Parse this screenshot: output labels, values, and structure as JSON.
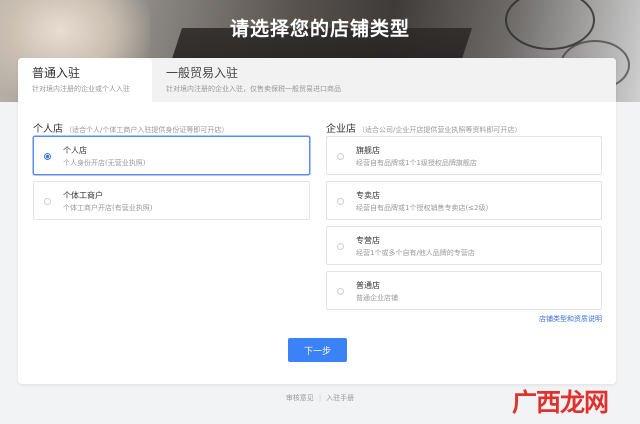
{
  "header": {
    "title": "请选择您的店铺类型"
  },
  "tabs": [
    {
      "title": "普通入驻",
      "subtitle": "针对境内注册的企业或个人入驻"
    },
    {
      "title": "一般贸易入驻",
      "subtitle": "针对境内注册的企业入驻，仅售卖保税一般贸易进口商品"
    }
  ],
  "personal": {
    "heading": "个人店",
    "hint": "（适合个人/个体工商户入驻提供身份证等即可开店）",
    "options": [
      {
        "title": "个人店",
        "desc": "个人身份开店(无营业执照)"
      },
      {
        "title": "个体工商户",
        "desc": "个体工商户开店(有营业执照)"
      }
    ]
  },
  "enterprise": {
    "heading": "企业店",
    "hint": "（适合公司/企业开店提供营业执照等资料即可开店）",
    "options": [
      {
        "title": "旗舰店",
        "desc": "经营自有品牌或1个1级授权品牌旗舰店"
      },
      {
        "title": "专卖店",
        "desc": "经营自有品牌或1个授权销售专卖店(≤2级)"
      },
      {
        "title": "专营店",
        "desc": "经营1个或多个自有/他人品牌的专营店"
      },
      {
        "title": "普通店",
        "desc": "普通企业店铺"
      }
    ]
  },
  "help_link": "店铺类型和资质说明",
  "next_button": "下一步",
  "footer": {
    "left": "审核意见",
    "right": "入驻手册"
  },
  "watermark": "广西龙网",
  "colors": {
    "primary": "#3b82f6",
    "link": "#3b6fd8",
    "selected_border": "#5a8cf0"
  }
}
